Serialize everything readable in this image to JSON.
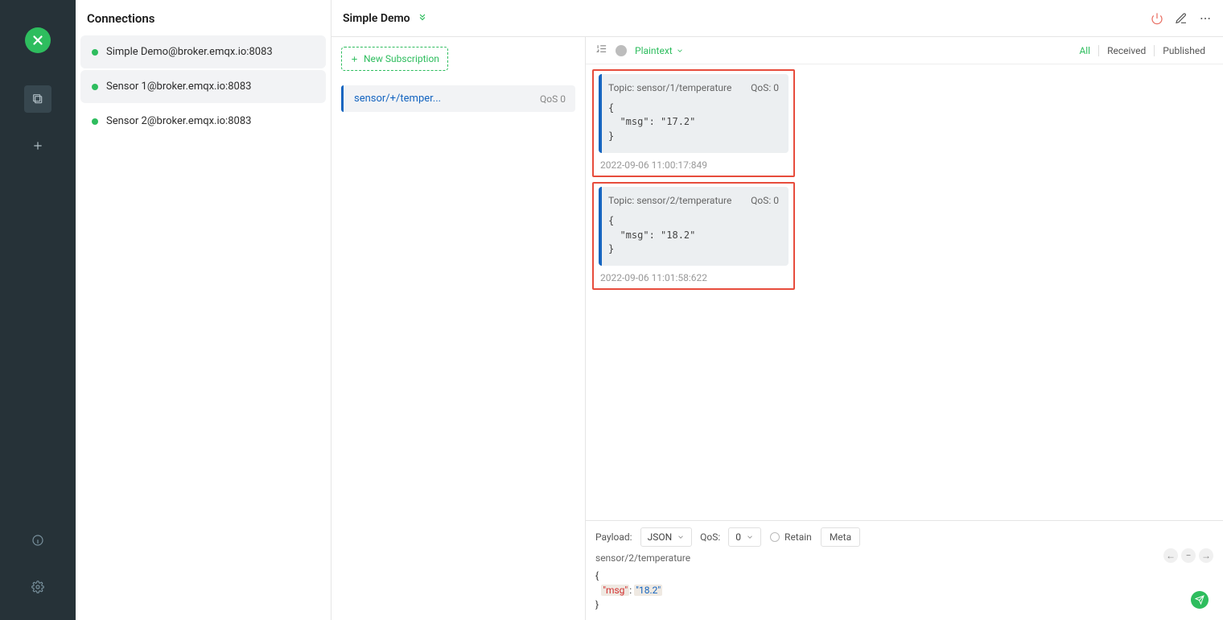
{
  "sidebar": {
    "title": "Connections",
    "connections": [
      {
        "label": "Simple Demo@broker.emqx.io:8083"
      },
      {
        "label": "Sensor 1@broker.emqx.io:8083"
      },
      {
        "label": "Sensor 2@broker.emqx.io:8083"
      }
    ]
  },
  "header": {
    "title": "Simple Demo"
  },
  "subscriptions": {
    "new_label": "New Subscription",
    "items": [
      {
        "topic": "sensor/+/temper...",
        "qos_label": "QoS 0"
      }
    ]
  },
  "msgbar": {
    "format": "Plaintext",
    "filters": [
      "All",
      "Received",
      "Published"
    ]
  },
  "messages": [
    {
      "topic_label": "Topic: sensor/1/temperature",
      "qos_label": "QoS: 0",
      "body": "{\n  \"msg\": \"17.2\"\n}",
      "timestamp": "2022-09-06 11:00:17:849"
    },
    {
      "topic_label": "Topic: sensor/2/temperature",
      "qos_label": "QoS: 0",
      "body": "{\n  \"msg\": \"18.2\"\n}",
      "timestamp": "2022-09-06 11:01:58:622"
    }
  ],
  "publish": {
    "payload_label": "Payload:",
    "payload_value": "JSON",
    "qos_label": "QoS:",
    "qos_value": "0",
    "retain_label": "Retain",
    "meta_label": "Meta",
    "topic": "sensor/2/temperature",
    "body_key": "\"msg\"",
    "body_val": "\"18.2\""
  }
}
